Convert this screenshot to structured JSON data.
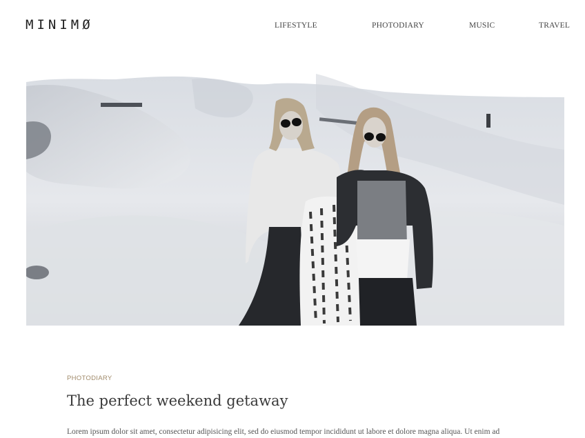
{
  "header": {
    "logo": "MINIMØ",
    "nav": [
      "LIFESTYLE",
      "PHOTODIARY",
      "MUSIC",
      "TRAVEL"
    ]
  },
  "hero": {
    "image_description_icon": "photo-two-women-dunes"
  },
  "post": {
    "category": "PHOTODIARY",
    "title": "The perfect weekend getaway",
    "excerpt": "Lorem ipsum dolor sit amet, consectetur adipisicing elit, sed do eiusmod tempor incididunt ut labore et dolore magna aliqua. Ut enim ad"
  },
  "colors": {
    "accent": "#a08a6a",
    "text": "#3a3a3a"
  }
}
